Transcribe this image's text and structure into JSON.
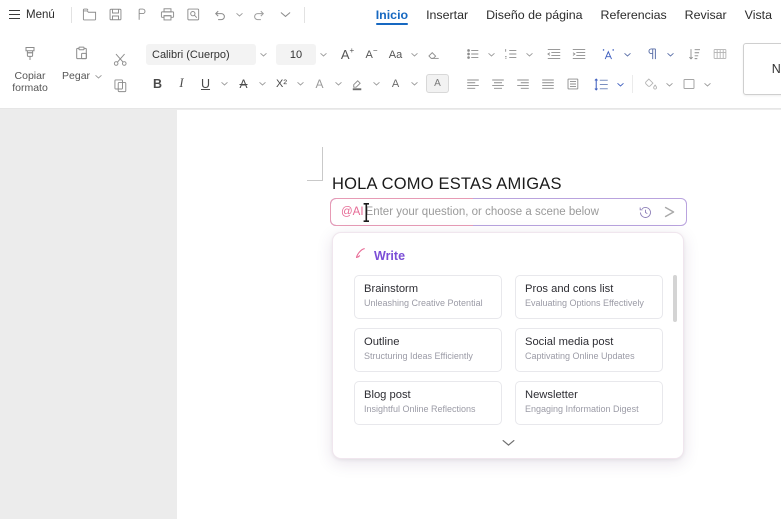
{
  "titlebar": {
    "menu_label": "Menú",
    "quick_access": [
      {
        "name": "open-folder-icon",
        "title": "Abrir"
      },
      {
        "name": "save-icon",
        "title": "Guardar"
      },
      {
        "name": "print-preview-pen-icon",
        "title": "Guardar como"
      },
      {
        "name": "print-icon",
        "title": "Imprimir"
      },
      {
        "name": "print-preview-icon",
        "title": "Vista previa de impresión"
      },
      {
        "name": "undo-icon",
        "title": "Deshacer"
      },
      {
        "name": "redo-icon",
        "title": "Rehacer"
      },
      {
        "name": "chevron-down-icon",
        "title": "Más"
      }
    ],
    "tabs": [
      {
        "label": "Inicio",
        "active": true
      },
      {
        "label": "Insertar",
        "active": false
      },
      {
        "label": "Diseño de página",
        "active": false
      },
      {
        "label": "Referencias",
        "active": false
      },
      {
        "label": "Revisar",
        "active": false
      },
      {
        "label": "Vista",
        "active": false
      }
    ]
  },
  "ribbon": {
    "clipboard": {
      "format_painter_label": "Copiar formato",
      "paste_label": "Pegar",
      "cut_name": "scissors-icon",
      "copy_name": "copy-icon"
    },
    "font": {
      "font_name": "Calibri (Cuerpo)",
      "font_size": "10",
      "grow_font": "A",
      "shrink_font": "A",
      "change_case": "Aa",
      "clear_format_name": "clear-formatting-icon",
      "bold": "B",
      "italic": "I",
      "underline": "U",
      "strikethrough": "A",
      "superscript": "X²",
      "text_effects": "A",
      "highlight": "A",
      "font_color": "A",
      "character_shading": "A"
    },
    "paragraph": {
      "row1": [
        "bullet-list-icon",
        "numbered-list-icon",
        "decrease-indent-icon",
        "increase-indent-icon",
        "phonetic-guide-icon",
        "paragraph-marks-icon",
        "sort-icon",
        "multilevel-list-icon"
      ],
      "row2": [
        "align-left-icon",
        "align-center-icon",
        "align-right-icon",
        "align-justify-icon",
        "distributed-align-icon",
        "line-spacing-icon",
        "shading-icon",
        "borders-icon"
      ]
    },
    "styles": {
      "normal_label": "Norm"
    }
  },
  "document": {
    "heading_text": "HOLA COMO ESTAS AMIGAS"
  },
  "ai_input": {
    "tag": "@AI",
    "placeholder": "Enter your question, or choose a scene below",
    "history_icon": "history-icon",
    "send_icon": "send-arrow-icon"
  },
  "ai_panel": {
    "section_title": "Write",
    "section_icon": "pencil-icon",
    "expand_icon": "chevron-down-icon",
    "cards": [
      {
        "title": "Brainstorm",
        "subtitle": "Unleashing Creative Potential"
      },
      {
        "title": "Pros and cons list",
        "subtitle": "Evaluating Options Effectively"
      },
      {
        "title": "Outline",
        "subtitle": "Structuring Ideas Efficiently"
      },
      {
        "title": "Social media post",
        "subtitle": "Captivating Online Updates"
      },
      {
        "title": "Blog post",
        "subtitle": "Insightful Online Reflections"
      },
      {
        "title": "Newsletter",
        "subtitle": "Engaging Information Digest"
      }
    ]
  },
  "colors": {
    "accent_tab": "#1668c1",
    "ai_pink": "#e66a95",
    "ai_purple": "#7b4ed6",
    "input_border_purple": "#b9a3de",
    "canvas_gray": "#ececec"
  }
}
